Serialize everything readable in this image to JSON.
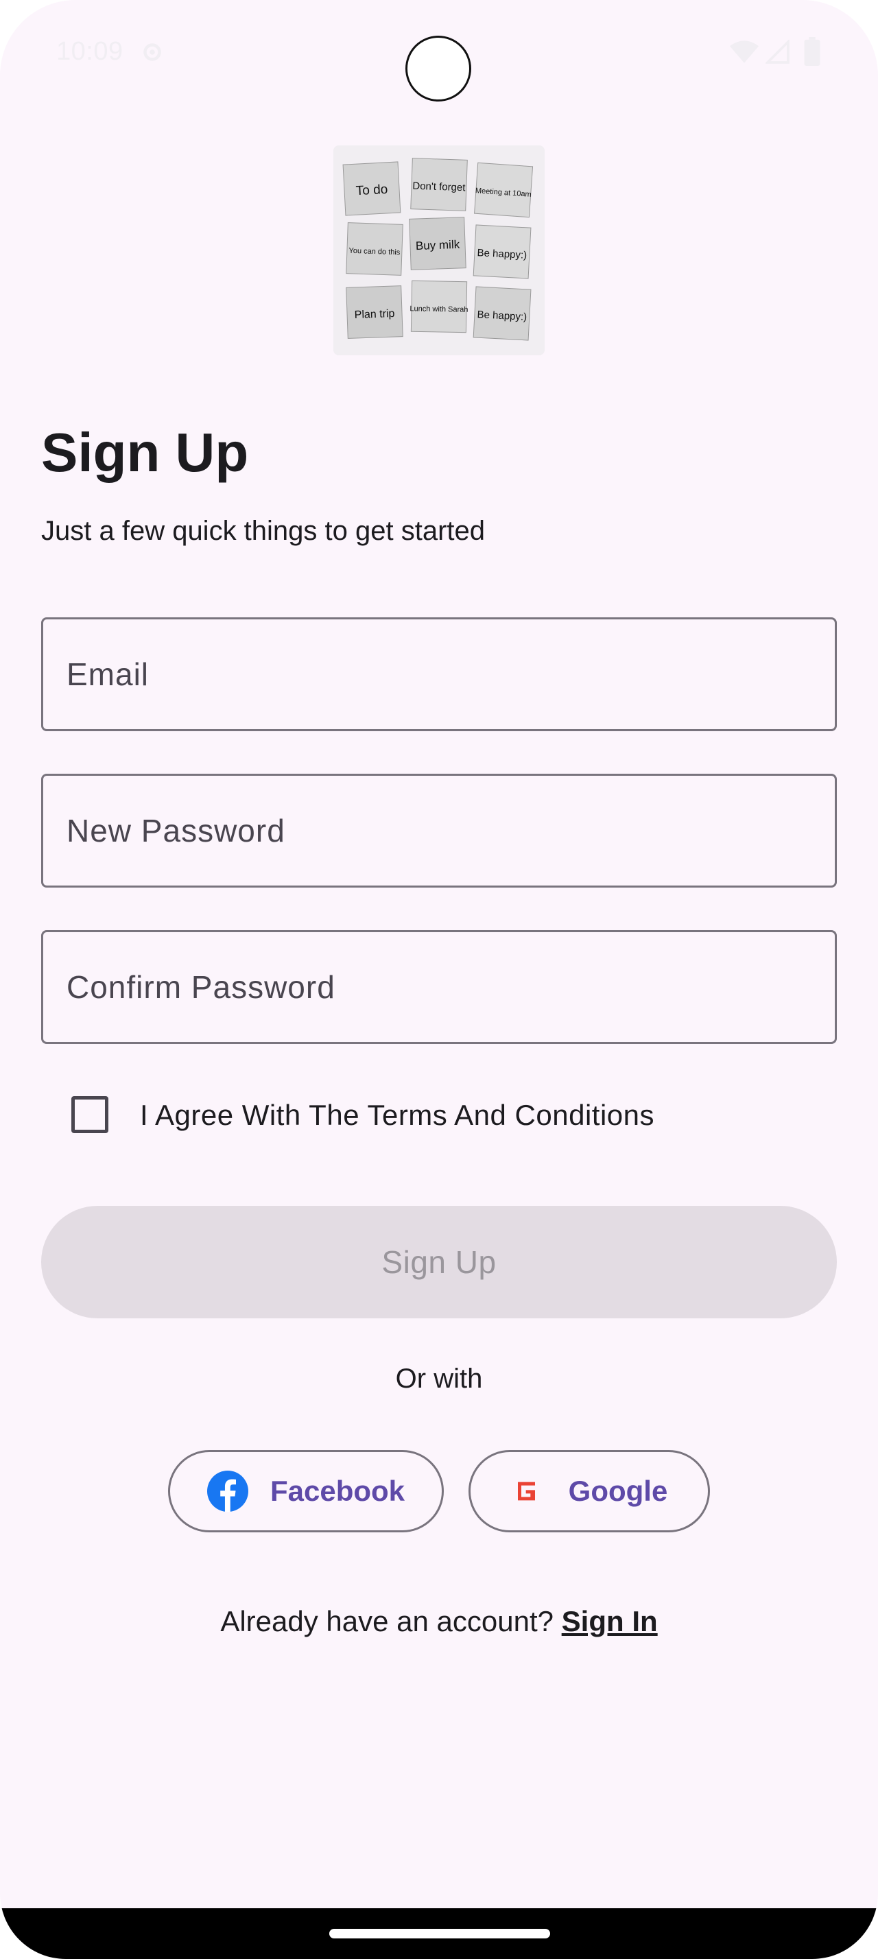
{
  "status_bar": {
    "time": "10:09",
    "icons": [
      "gear-icon",
      "wifi-icon",
      "signal-icon",
      "battery-icon"
    ]
  },
  "logo": {
    "notes": [
      "To do",
      "Don't forget",
      "Meeting at 10am",
      "You can do this",
      "Buy milk",
      "Be happy:)",
      "Plan trip",
      "Lunch with Sarah",
      "Be happy:)"
    ]
  },
  "header": {
    "title": "Sign Up",
    "subtitle": "Just a few quick things to get started"
  },
  "form": {
    "email_placeholder": "Email",
    "new_password_placeholder": "New Password",
    "confirm_password_placeholder": "Confirm Password",
    "terms_label": "I Agree With The Terms And Conditions",
    "terms_checked": false,
    "submit_label": "Sign Up"
  },
  "social": {
    "divider_text": "Or with",
    "facebook_label": "Facebook",
    "google_label": "Google"
  },
  "footer": {
    "prompt": "Already have an account?",
    "signin_label": "Sign In"
  },
  "colors": {
    "background": "#fcf5fc",
    "accent": "#5e4aa8",
    "facebook": "#1877f2",
    "google": "#ea4335",
    "disabled_button": "#e3dce3"
  }
}
